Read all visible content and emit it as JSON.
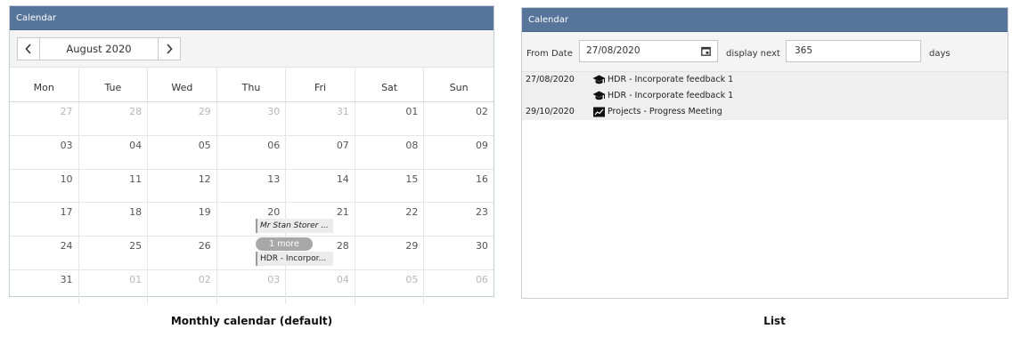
{
  "monthly_panel": {
    "header_title": "Calendar",
    "month_label": "August 2020",
    "weekdays": [
      "Mon",
      "Tue",
      "Wed",
      "Thu",
      "Fri",
      "Sat",
      "Sun"
    ],
    "weeks": [
      [
        {
          "d": "27",
          "other": true
        },
        {
          "d": "28",
          "other": true
        },
        {
          "d": "29",
          "other": true
        },
        {
          "d": "30",
          "other": true
        },
        {
          "d": "31",
          "other": true
        },
        {
          "d": "01"
        },
        {
          "d": "02"
        }
      ],
      [
        {
          "d": "03"
        },
        {
          "d": "04"
        },
        {
          "d": "05"
        },
        {
          "d": "06"
        },
        {
          "d": "07"
        },
        {
          "d": "08"
        },
        {
          "d": "09"
        }
      ],
      [
        {
          "d": "10"
        },
        {
          "d": "11"
        },
        {
          "d": "12"
        },
        {
          "d": "13"
        },
        {
          "d": "14"
        },
        {
          "d": "15"
        },
        {
          "d": "16"
        }
      ],
      [
        {
          "d": "17"
        },
        {
          "d": "18"
        },
        {
          "d": "19"
        },
        {
          "d": "20"
        },
        {
          "d": "21"
        },
        {
          "d": "22"
        },
        {
          "d": "23"
        }
      ],
      [
        {
          "d": "24"
        },
        {
          "d": "25"
        },
        {
          "d": "26"
        },
        {
          "d": "27"
        },
        {
          "d": "28"
        },
        {
          "d": "29"
        },
        {
          "d": "30"
        }
      ],
      [
        {
          "d": "31"
        },
        {
          "d": "01",
          "other": true
        },
        {
          "d": "02",
          "other": true
        },
        {
          "d": "03",
          "other": true
        },
        {
          "d": "04",
          "other": true
        },
        {
          "d": "05",
          "other": true
        },
        {
          "d": "06",
          "other": true
        }
      ]
    ],
    "events": {
      "ev1": "Mr Stan Storer ...",
      "ev2": "HDR - Incorpor..."
    },
    "more_label": "1 more"
  },
  "list_panel": {
    "header_title": "Calendar",
    "from_date_label": "From Date",
    "from_date_value": "27/08/2020",
    "display_next_label": "display next",
    "days_value": "365",
    "days_label": "days",
    "items": [
      {
        "date": "27/08/2020",
        "icon": "graduation-cap-icon",
        "text": "HDR - Incorporate feedback 1"
      },
      {
        "date": "",
        "icon": "graduation-cap-icon",
        "text": "HDR - Incorporate feedback 1"
      },
      {
        "date": "29/10/2020",
        "icon": "chart-icon",
        "text": "Projects - Progress Meeting"
      }
    ]
  },
  "captions": {
    "left": "Monthly calendar (default)",
    "right": "List"
  }
}
